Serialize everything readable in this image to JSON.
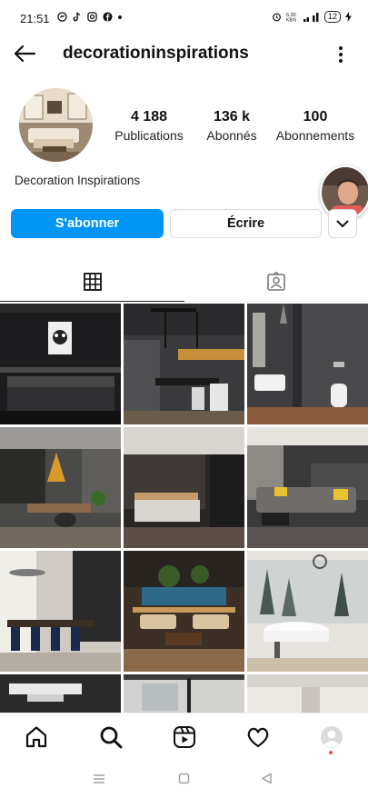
{
  "status_bar": {
    "time": "21:51",
    "battery": "12"
  },
  "header": {
    "username": "decorationinspirations"
  },
  "profile": {
    "display_name": "Decoration Inspirations",
    "stats": [
      {
        "value": "4 188",
        "label": "Publications"
      },
      {
        "value": "136 k",
        "label": "Abonnés"
      },
      {
        "value": "100",
        "label": "Abonnements"
      }
    ]
  },
  "actions": {
    "follow_label": "S'abonner",
    "message_label": "Écrire"
  },
  "colors": {
    "primary_button": "#0095f6",
    "notification_dot": "#ed4956"
  },
  "tabs": [
    {
      "icon": "grid-icon",
      "active": true
    },
    {
      "icon": "tagged-icon",
      "active": false
    }
  ],
  "posts": [
    {
      "icon": "dark-bedroom-panda-art"
    },
    {
      "icon": "dark-kitchen-dining"
    },
    {
      "icon": "dark-bathroom"
    },
    {
      "icon": "dark-kitchen-island"
    },
    {
      "icon": "dark-bedroom-wood"
    },
    {
      "icon": "dark-living-room-yellow-pillows"
    },
    {
      "icon": "dining-room-blue-chairs"
    },
    {
      "icon": "open-living-room-pool"
    },
    {
      "icon": "bathroom-forest-view"
    },
    {
      "icon": "ceiling-detail"
    },
    {
      "icon": "bathroom-window"
    },
    {
      "icon": "white-room"
    }
  ],
  "bottom_nav": [
    {
      "icon": "home-icon"
    },
    {
      "icon": "search-icon"
    },
    {
      "icon": "reels-icon"
    },
    {
      "icon": "heart-icon"
    },
    {
      "icon": "profile-icon"
    }
  ]
}
